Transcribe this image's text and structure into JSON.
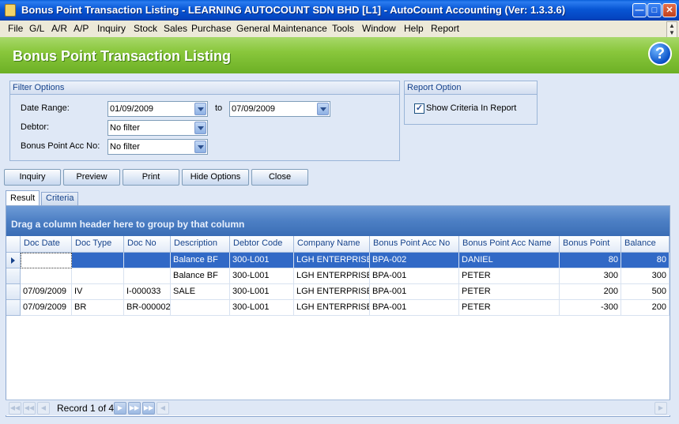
{
  "window": {
    "title": "Bonus Point Transaction Listing - LEARNING AUTOCOUNT SDN BHD [L1] - AutoCount Accounting (Ver: 1.3.3.6)"
  },
  "menu": [
    "File",
    "G/L",
    "A/R",
    "A/P",
    "Inquiry",
    "Stock",
    "Sales",
    "Purchase",
    "General Maintenance",
    "Tools",
    "Window",
    "Help",
    "Report"
  ],
  "header": {
    "title": "Bonus Point Transaction Listing",
    "help_icon": "?"
  },
  "filter": {
    "title": "Filter Options",
    "date_range_label": "Date Range:",
    "date_from": "01/09/2009",
    "to_label": "to",
    "date_to": "07/09/2009",
    "debtor_label": "Debtor:",
    "debtor_value": "No filter",
    "bonus_acc_label": "Bonus Point Acc No:",
    "bonus_acc_value": "No filter"
  },
  "report_option": {
    "title": "Report Option",
    "show_criteria_label": "Show Criteria In Report",
    "show_criteria_checked": true
  },
  "buttons": {
    "inquiry": "Inquiry",
    "preview": "Preview",
    "print": "Print",
    "hide_options": "Hide Options",
    "close": "Close"
  },
  "tabs": {
    "result": "Result",
    "criteria": "Criteria"
  },
  "grid": {
    "group_hint": "Drag a column header here to group by that column",
    "columns": [
      "Doc Date",
      "Doc Type",
      "Doc No",
      "Description",
      "Debtor Code",
      "Company Name",
      "Bonus Point Acc No",
      "Bonus Point Acc Name",
      "Bonus Point",
      "Balance"
    ],
    "rows": [
      [
        "",
        "",
        "",
        "Balance BF",
        "300-L001",
        "LGH ENTERPRISE",
        "BPA-002",
        "DANIEL",
        "80",
        "80"
      ],
      [
        "",
        "",
        "",
        "Balance BF",
        "300-L001",
        "LGH ENTERPRISE",
        "BPA-001",
        "PETER",
        "300",
        "300"
      ],
      [
        "07/09/2009",
        "IV",
        "I-000033",
        "SALE",
        "300-L001",
        "LGH ENTERPRISE",
        "BPA-001",
        "PETER",
        "200",
        "500"
      ],
      [
        "07/09/2009",
        "BR",
        "BR-000002",
        "",
        "300-L001",
        "LGH ENTERPRISE",
        "BPA-001",
        "PETER",
        "-300",
        "200"
      ]
    ]
  },
  "navigator": {
    "record_text": "Record 1 of 4"
  }
}
